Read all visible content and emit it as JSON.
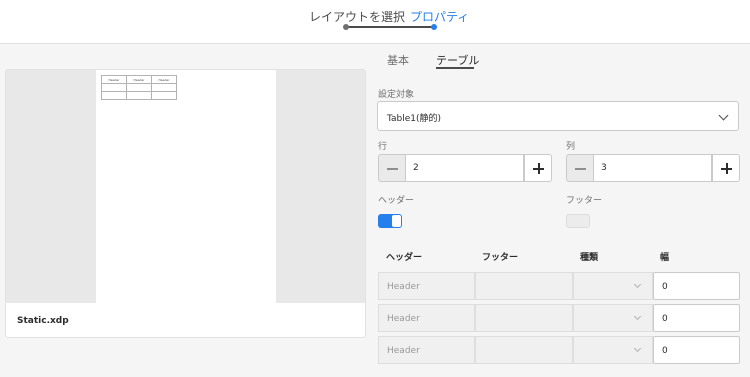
{
  "wizard": {
    "step1_label": "レイアウトを選択",
    "step2_label": "プロパティ"
  },
  "preview": {
    "filename": "Static.xdp",
    "mini_table": {
      "headers": [
        "Header",
        "Header",
        "Header"
      ],
      "rows": 2
    }
  },
  "tabs": {
    "basic": "基本",
    "table": "テーブル",
    "active": "テーブル"
  },
  "settings": {
    "target_label": "設定対象",
    "target_value": "Table1(静的)",
    "row_label": "行",
    "row_value": "2",
    "column_label": "列",
    "column_value": "3",
    "header_label": "ヘッダー",
    "header_enabled": true,
    "footer_label": "フッター",
    "footer_enabled": false
  },
  "columns_grid": {
    "headers": {
      "header": "ヘッダー",
      "footer": "フッター",
      "type": "種類",
      "width": "幅"
    },
    "rows": [
      {
        "header": "Header",
        "footer": "",
        "type": "",
        "width": "0"
      },
      {
        "header": "Header",
        "footer": "",
        "type": "",
        "width": "0"
      },
      {
        "header": "Header",
        "footer": "",
        "type": "",
        "width": "0"
      }
    ]
  },
  "colors": {
    "accent": "#2680eb",
    "background": "#f5f5f5"
  }
}
